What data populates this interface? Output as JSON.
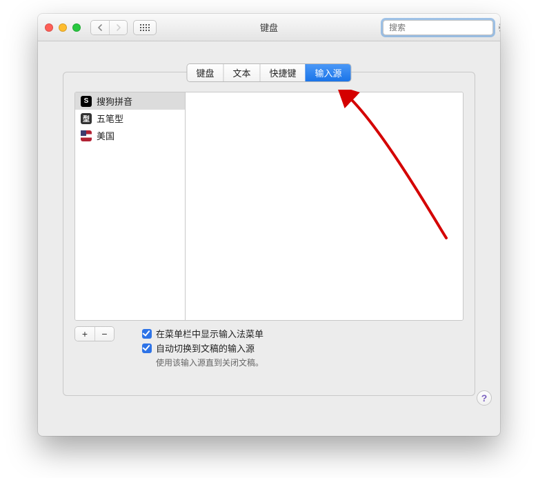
{
  "window": {
    "title": "键盘"
  },
  "search": {
    "placeholder": "搜索"
  },
  "tabs": [
    {
      "label": "键盘",
      "active": false
    },
    {
      "label": "文本",
      "active": false
    },
    {
      "label": "快捷键",
      "active": false
    },
    {
      "label": "输入源",
      "active": true
    }
  ],
  "input_sources": [
    {
      "label": "搜狗拼音",
      "icon": "sogou",
      "icon_glyph": "S",
      "selected": true
    },
    {
      "label": "五笔型",
      "icon": "wubi",
      "icon_glyph": "型",
      "selected": false
    },
    {
      "label": "美国",
      "icon": "us",
      "icon_glyph": "",
      "selected": false
    }
  ],
  "add_label": "+",
  "remove_label": "−",
  "options": {
    "show_menu": {
      "label": "在菜单栏中显示输入法菜单",
      "checked": true
    },
    "auto_switch": {
      "label": "自动切换到文稿的输入源",
      "checked": true
    },
    "auto_switch_note": "使用该输入源直到关闭文稿。"
  },
  "help_label": "?"
}
